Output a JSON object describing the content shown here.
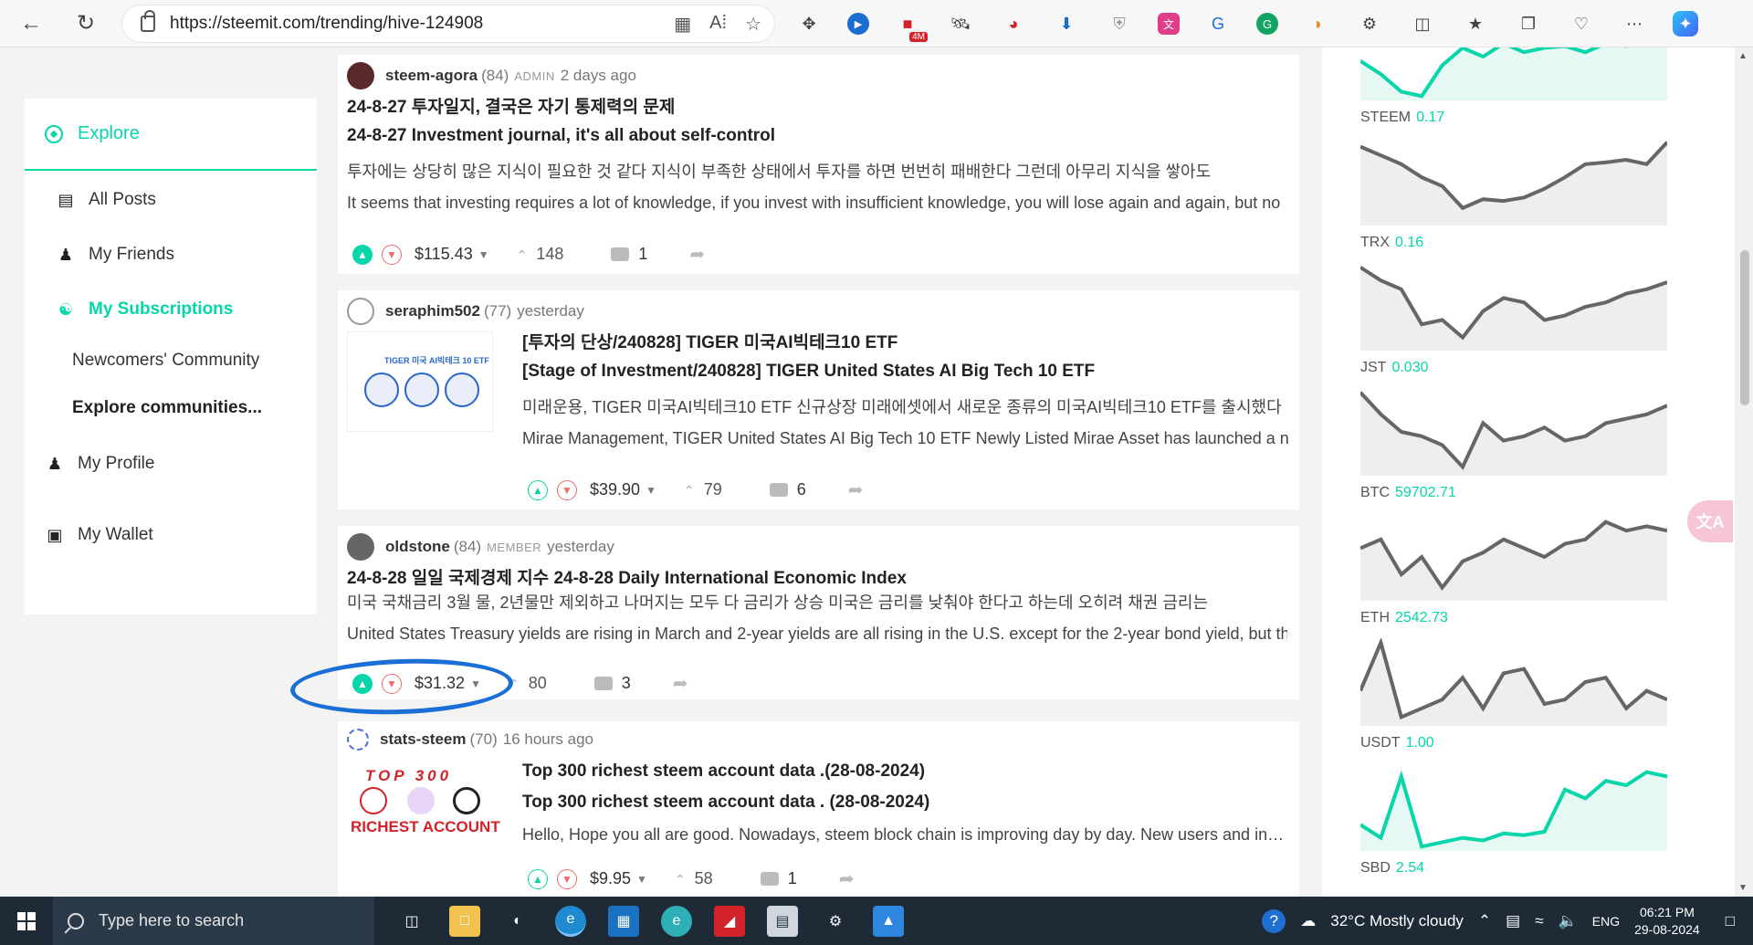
{
  "browser": {
    "url": "https://steemit.com/trending/hive-124908",
    "extension_badge": "4M"
  },
  "nav": {
    "explore": "Explore",
    "items": [
      {
        "label": "All Posts",
        "icon": "list-icon"
      },
      {
        "label": "My Friends",
        "icon": "friends-icon"
      },
      {
        "label": "My Subscriptions",
        "icon": "subscriptions-icon"
      }
    ],
    "sub": [
      "Newcomers' Community",
      "Explore communities..."
    ],
    "lower": [
      {
        "label": "My Profile",
        "icon": "profile-icon"
      },
      {
        "label": "My Wallet",
        "icon": "wallet-icon"
      }
    ]
  },
  "posts": [
    {
      "author": "steem-agora",
      "rep": "(84)",
      "role": "ADMIN",
      "time": "2 days ago",
      "title": "24-8-27 투자일지, 결국은 자기 통제력의 문제",
      "title2": "24-8-27 Investment journal, it's all about self-control",
      "body": "투자에는 상당히 많은 지식이 필요한 것 같다 지식이 부족한 상태에서 투자를 하면 번번히 패배한다 그런데 아무리 지식을 쌓아도",
      "body2": "It seems that investing requires a lot of knowledge, if you invest with insufficient knowledge, you will lose again and again, but no",
      "payout": "$115.43",
      "votes": "148",
      "comments": "1"
    },
    {
      "author": "seraphim502",
      "rep": "(77)",
      "role": "",
      "time": "yesterday",
      "title": "[투자의 단상/240828] TIGER 미국AI빅테크10 ETF",
      "title2": "[Stage of Investment/240828] TIGER United States AI Big Tech 10 ETF",
      "body": "미래운용, TIGER 미국AI빅테크10 ETF 신규상장 미래에셋에서 새로운 종류의 미국AI빅테크10 ETF를 출시했다",
      "body2": "Mirae Management, TIGER United States AI Big Tech 10 ETF Newly Listed Mirae Asset has launched a new type of",
      "payout": "$39.90",
      "votes": "79",
      "comments": "6",
      "thumb_title": "TIGER 미국 AI빅테크 10 ETF"
    },
    {
      "author": "oldstone",
      "rep": "(84)",
      "role": "MEMBER",
      "time": "yesterday",
      "title": "24-8-28 일일 국제경제 지수 24-8-28 Daily International Economic Index",
      "body": "미국 국채금리 3월 물, 2년물만 제외하고 나머지는 모두 다 금리가 상승 미국은 금리를 낮춰야 한다고 하는데 오히려 채권 금리는",
      "body2": "United States Treasury yields are rising in March and 2-year yields are all rising in the U.S. except for the 2-year bond yield, but the",
      "payout": "$31.32",
      "votes": "80",
      "comments": "3"
    },
    {
      "author": "stats-steem",
      "rep": "(70)",
      "role": "",
      "time": "16 hours ago",
      "title": "Top 300 richest steem account data .(28-08-2024)",
      "title2": "Top 300 richest steem account data . (28-08-2024)",
      "body": "Hello, Hope you all are good. Nowadays, steem block chain is improving day by day. New users and investors are joining",
      "payout": "$9.95",
      "votes": "58",
      "comments": "1",
      "thumb_top": "TOP 300",
      "thumb_bottom": "RICHEST ACCOUNT"
    }
  ],
  "market": [
    {
      "symbol": "STEEM",
      "price": "0.17",
      "trend": [
        0.55,
        0.7,
        0.9,
        0.95,
        0.6,
        0.4,
        0.5,
        0.35,
        0.45,
        0.4,
        0.38,
        0.45,
        0.35,
        0.38,
        0.33,
        0.3
      ],
      "color": "#06d6a9"
    },
    {
      "symbol": "TRX",
      "price": "0.16",
      "trend": [
        0.1,
        0.2,
        0.3,
        0.45,
        0.55,
        0.8,
        0.7,
        0.72,
        0.68,
        0.58,
        0.45,
        0.3,
        0.28,
        0.25,
        0.3,
        0.05
      ],
      "color": "#666"
    },
    {
      "symbol": "JST",
      "price": "0.030",
      "trend": [
        0.05,
        0.2,
        0.3,
        0.7,
        0.65,
        0.85,
        0.55,
        0.4,
        0.45,
        0.65,
        0.6,
        0.5,
        0.45,
        0.35,
        0.3,
        0.22
      ],
      "color": "#666"
    },
    {
      "symbol": "BTC",
      "price": "59702.71",
      "trend": [
        0.05,
        0.3,
        0.5,
        0.55,
        0.65,
        0.9,
        0.4,
        0.6,
        0.55,
        0.45,
        0.6,
        0.55,
        0.4,
        0.35,
        0.3,
        0.2
      ],
      "color": "#666"
    },
    {
      "symbol": "ETH",
      "price": "2542.73",
      "trend": [
        0.4,
        0.3,
        0.7,
        0.5,
        0.85,
        0.55,
        0.45,
        0.3,
        0.4,
        0.5,
        0.35,
        0.3,
        0.1,
        0.2,
        0.15,
        0.2
      ],
      "color": "#666"
    },
    {
      "symbol": "USDT",
      "price": "1.00",
      "trend": [
        0.6,
        0.05,
        0.9,
        0.8,
        0.7,
        0.45,
        0.8,
        0.4,
        0.35,
        0.75,
        0.7,
        0.5,
        0.45,
        0.8,
        0.6,
        0.7
      ],
      "color": "#666"
    },
    {
      "symbol": "SBD",
      "price": "2.54",
      "trend": [
        0.7,
        0.85,
        0.15,
        0.95,
        0.9,
        0.85,
        0.88,
        0.8,
        0.82,
        0.78,
        0.3,
        0.4,
        0.2,
        0.25,
        0.1,
        0.15
      ],
      "color": "#06d6a9"
    }
  ],
  "taskbar": {
    "search_placeholder": "Type here to search",
    "weather": "32°C  Mostly cloudy",
    "lang": "ENG",
    "time": "06:21 PM",
    "date": "29-08-2024"
  }
}
